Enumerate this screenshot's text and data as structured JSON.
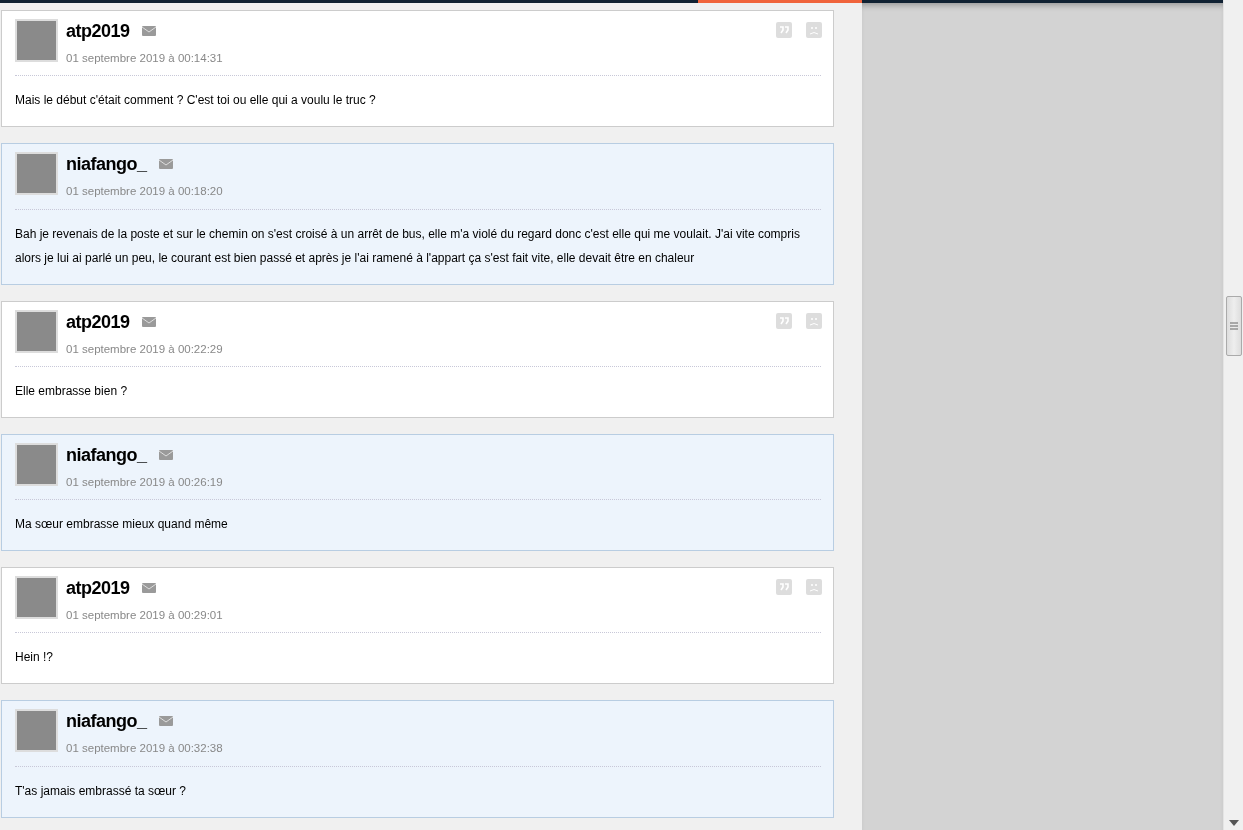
{
  "posts": [
    {
      "author": "atp2019",
      "date": "01 septembre 2019 à 00:14:31",
      "text": "Mais le début c'était comment ? C'est toi ou elle qui a voulu le truc ?",
      "kind": "plain"
    },
    {
      "author": "niafango_",
      "date": "01 septembre 2019 à 00:18:20",
      "text": "Bah je revenais de la poste et sur le chemin on s'est croisé à un arrêt de bus, elle m'a violé du regard donc c'est elle qui me voulait. J'ai vite compris alors je lui ai parlé un peu, le courant est bien passé et après je l'ai ramené à l'appart ça s'est fait vite, elle devait être en chaleur",
      "kind": "author"
    },
    {
      "author": "atp2019",
      "date": "01 septembre 2019 à 00:22:29",
      "text": "Elle embrasse bien ?",
      "kind": "plain"
    },
    {
      "author": "niafango_",
      "date": "01 septembre 2019 à 00:26:19",
      "text": "Ma sœur embrasse mieux quand même",
      "kind": "author"
    },
    {
      "author": "atp2019",
      "date": "01 septembre 2019 à 00:29:01",
      "text": "Hein !?",
      "kind": "plain"
    },
    {
      "author": "niafango_",
      "date": "01 septembre 2019 à 00:32:38",
      "text": "T'as jamais embrassé ta sœur ?",
      "kind": "author"
    }
  ]
}
